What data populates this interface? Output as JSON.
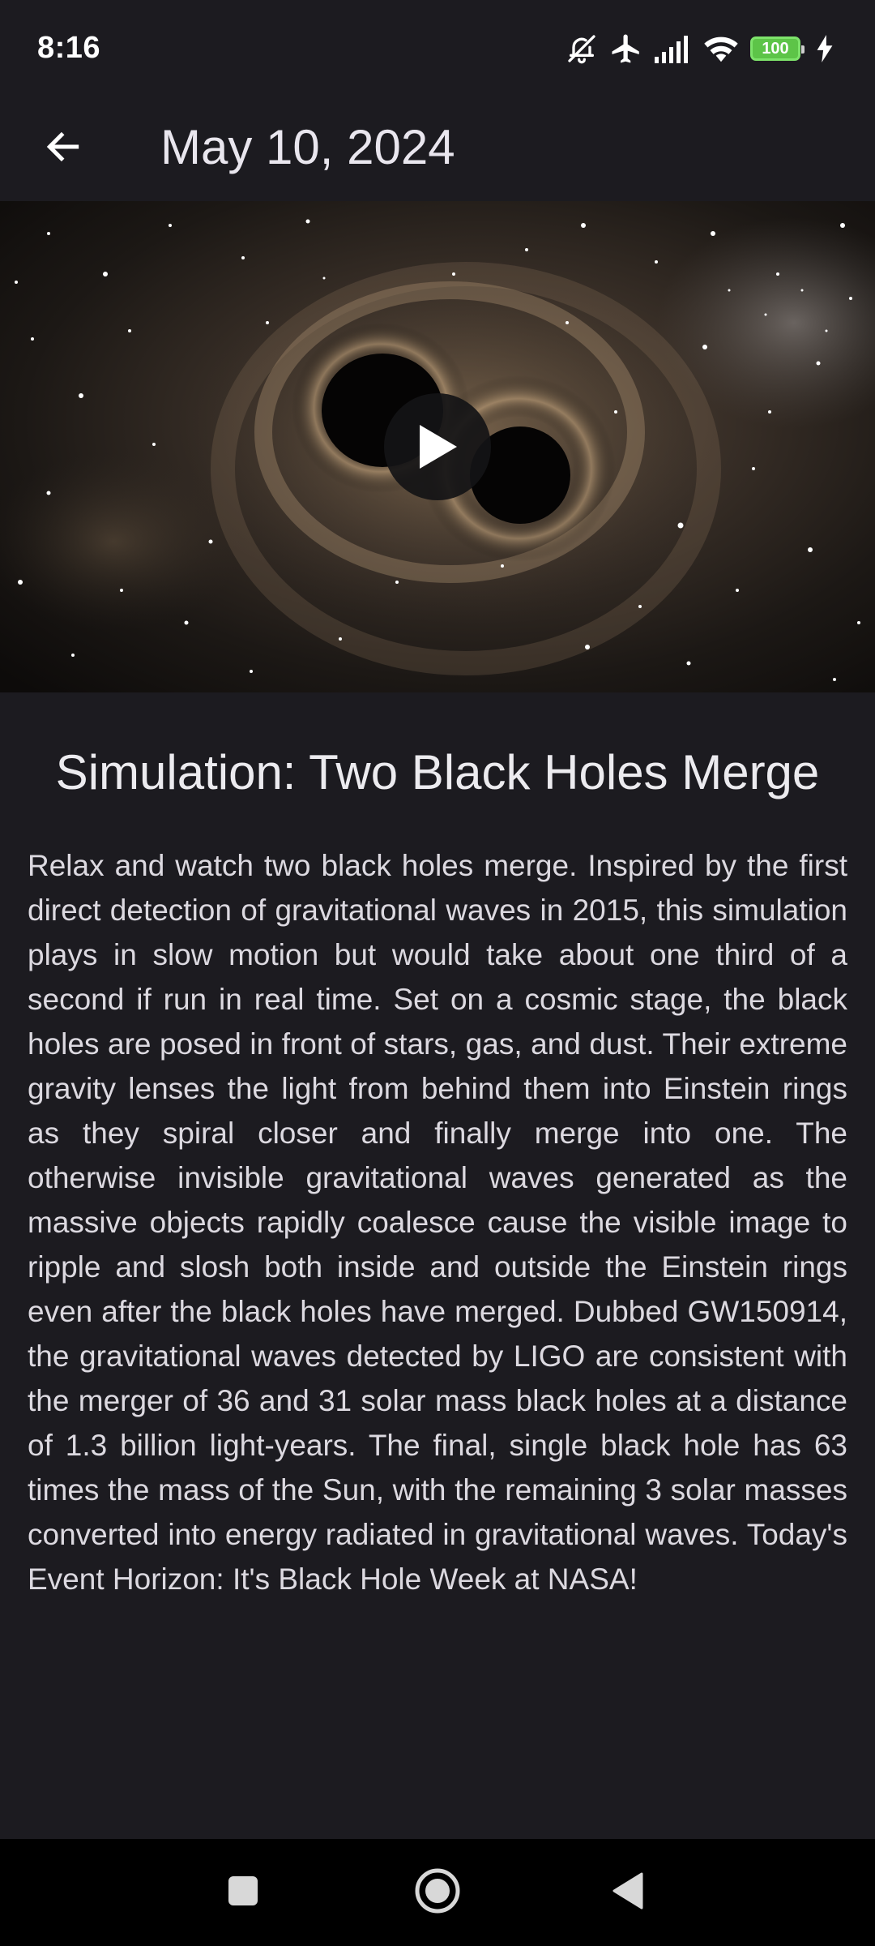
{
  "status_bar": {
    "time": "8:16",
    "battery_level": "100",
    "icons": [
      "bell-off-icon",
      "airplane-icon",
      "signal-icon",
      "wifi-icon",
      "battery-icon",
      "charging-icon"
    ]
  },
  "app_bar": {
    "back_icon": "arrow-left-icon",
    "title": "May 10, 2024"
  },
  "media": {
    "type": "video",
    "play_icon": "play-icon"
  },
  "article": {
    "title": "Simulation: Two Black Holes Merge",
    "body": "Relax and watch two black holes merge. Inspired by the first direct detection of gravitational waves in 2015, this simulation plays in slow motion but would take about one third of a second if run in real time. Set on a cosmic stage, the black holes are posed in front of stars, gas, and dust. Their extreme gravity lenses the light from behind them into Einstein rings as they spiral closer and finally merge into one. The otherwise invisible gravitational waves generated as the massive objects rapidly coalesce cause the visible image to ripple and slosh both inside and outside the Einstein rings even after the black holes have merged. Dubbed GW150914, the gravitational waves detected by LIGO are consistent with the merger of 36 and 31 solar mass black holes at a distance of 1.3 billion light-years. The final, single black hole has 63 times the mass of the Sun, with the remaining 3 solar masses converted into energy radiated in gravitational waves. Today's Event Horizon: It's Black Hole Week at NASA!"
  },
  "nav_bar": {
    "items": [
      "recents-square-icon",
      "home-circle-icon",
      "back-triangle-icon"
    ]
  },
  "colors": {
    "background": "#1c1b20",
    "nav_background": "#000000",
    "battery_green": "#5dc448"
  }
}
